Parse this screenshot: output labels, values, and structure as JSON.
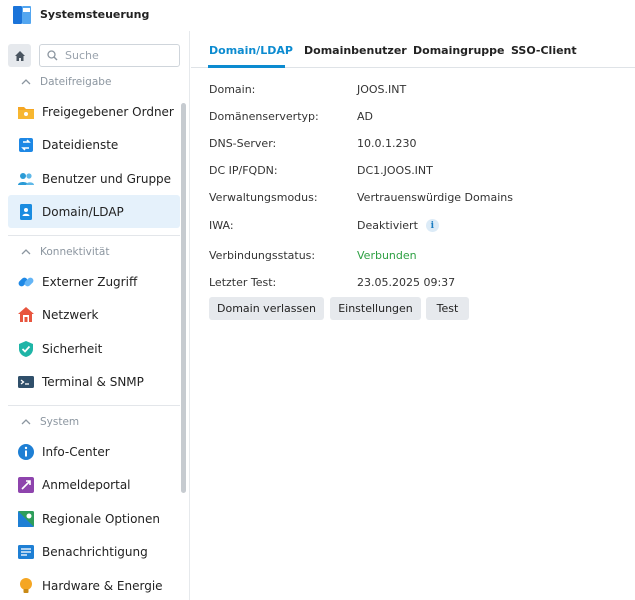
{
  "window": {
    "title": "Systemsteuerung"
  },
  "search": {
    "placeholder": "Suche"
  },
  "sidebar": {
    "sections": [
      {
        "label": "Dateifreigabe"
      },
      {
        "label": "Konnektivität"
      },
      {
        "label": "System"
      }
    ],
    "items": [
      {
        "label": "Freigegebener Ordner",
        "icon": "shared-folder-icon"
      },
      {
        "label": "Dateidienste",
        "icon": "file-services-icon"
      },
      {
        "label": "Benutzer und Gruppe",
        "icon": "user-group-icon"
      },
      {
        "label": "Domain/LDAP",
        "icon": "domain-ldap-icon",
        "active": true
      },
      {
        "label": "Externer Zugriff",
        "icon": "external-access-icon"
      },
      {
        "label": "Netzwerk",
        "icon": "network-icon"
      },
      {
        "label": "Sicherheit",
        "icon": "shield-icon"
      },
      {
        "label": "Terminal & SNMP",
        "icon": "terminal-icon"
      },
      {
        "label": "Info-Center",
        "icon": "info-icon"
      },
      {
        "label": "Anmeldeportal",
        "icon": "login-portal-icon"
      },
      {
        "label": "Regionale Optionen",
        "icon": "regional-options-icon"
      },
      {
        "label": "Benachrichtigung",
        "icon": "notification-icon"
      },
      {
        "label": "Hardware & Energie",
        "icon": "hardware-power-icon"
      }
    ]
  },
  "tabs": [
    {
      "label": "Domain/LDAP",
      "active": true
    },
    {
      "label": "Domainbenutzer"
    },
    {
      "label": "Domaingruppe"
    },
    {
      "label": "SSO-Client"
    }
  ],
  "details": [
    {
      "key": "Domain:",
      "value": "JOOS.INT"
    },
    {
      "key": "Domänenservertyp:",
      "value": "AD"
    },
    {
      "key": "DNS-Server:",
      "value": "10.0.1.230"
    },
    {
      "key": "DC IP/FQDN:",
      "value": "DC1.JOOS.INT"
    },
    {
      "key": "Verwaltungsmodus:",
      "value": "Vertrauenswürdige Domains"
    },
    {
      "key": "IWA:",
      "value": "Deaktiviert"
    },
    {
      "key": "Verbindungsstatus:",
      "value": "Verbunden"
    },
    {
      "key": "Letzter Test:",
      "value": "23.05.2025 09:37"
    }
  ],
  "buttons": {
    "leave": "Domain verlassen",
    "settings": "Einstellungen",
    "test": "Test"
  },
  "colors": {
    "accent": "#0c8bd0",
    "status_ok": "#2ea043",
    "active_bg": "#e5f1fb"
  }
}
